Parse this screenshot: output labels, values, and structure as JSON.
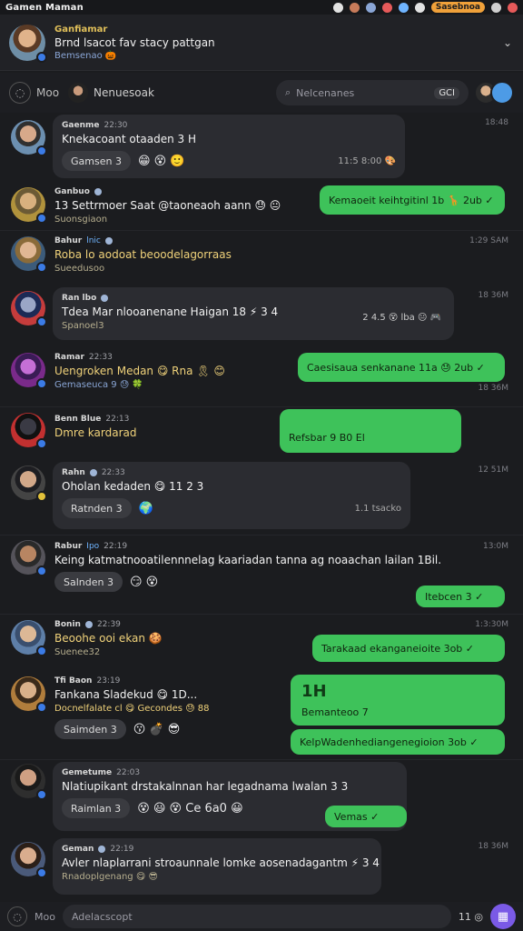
{
  "status_bar": {
    "title": "Gamen Maman",
    "pill": "Sasebnoa"
  },
  "header": {
    "name": "Ganfiamar",
    "status": "Brnd lsacot fav stacy pattgan",
    "sub": "Bemsenao 🎃"
  },
  "toolbar": {
    "left_label": "Moo",
    "pill_label": "Nenuesoak",
    "search_placeholder": "Nelcenanes",
    "search_chip": "GCI"
  },
  "messages": [
    {
      "name": "Gaenme",
      "time": "22:30",
      "text": "Knekacoant otaaden 3 H",
      "reaction_label": "Gamsen 3",
      "reactions": "😁 😵 🙂",
      "meta_right": "11:5 8:00 🎨",
      "stamp": "18:48",
      "green": ""
    },
    {
      "name": "Ganbuo",
      "tag": "",
      "text": "13 Settrmoer Saat @taoneaoh aann 😓 😐",
      "sub": "Suonsgiaon",
      "stamp": "",
      "green": "Kemaoeit keihtgitinl 1b 🦒 2ub ✓"
    },
    {
      "name": "Bahur",
      "tag": "lnic",
      "text": "Roba lo aodoat beoodelagorraas",
      "sub": "Sueedusoo",
      "stamp": "1:29 SAM",
      "green": ""
    },
    {
      "name": "Ran lbo",
      "text": "Tdea Mar nlooanenane Haigan 18 ⚡ 3 4",
      "meta_right": "2 4.5 😵 lba 😐 🎮",
      "sub": "Spanoel3",
      "stamp": "18 36M",
      "green": ""
    },
    {
      "name": "Ramar",
      "time": "22:33",
      "text": "Uengroken Medan 😋 Rna 🎗 😊",
      "sub": "Gemaseuca 9 😓 🍀",
      "stamp": "18 36M",
      "green": "Caesisaua senkanane 11a 😓 2ub ✓"
    },
    {
      "name": "Benn Blue",
      "time": "22:13",
      "text": "Dmre kardarad",
      "stamp": "",
      "green": "Refsbar 9 B0 El"
    },
    {
      "name": "Rahn",
      "tag": "",
      "time": "22:33",
      "text": "Oholan kedaden 😋 11 2 3",
      "reaction_label": "Ratnden 3",
      "reactions": "🌍",
      "meta_right": "1.1 tsacko",
      "stamp": "12 51M",
      "green": ""
    },
    {
      "name": "Rabur",
      "tag": "Ipo",
      "time": "22:19",
      "text": "Keing katmatnooatilennnelag kaariadan tanna ag noaachan lailan 1Bil.",
      "reaction_label": "Salnden 3",
      "reactions": "😏 😵",
      "stamp": "13:0M",
      "green": "Itebcen 3 ✓"
    },
    {
      "name": "Bonin",
      "time": "22:39",
      "text": "Beoohe ooi ekan 🍪",
      "sub": "Suenee32",
      "stamp": "1:3:30M",
      "green": "Tarakaad ekanganeioite 3ob ✓"
    },
    {
      "name": "Tfi Baon",
      "time": "23:19",
      "text": "Fankana Sladekud 😋 1D...",
      "sub": "Docnelfalate cl 😋 Gecondes 😓 88",
      "reaction_label": "Saimden 3",
      "reactions": "😗 💣 😎",
      "stamp": "",
      "green_big": "1H",
      "green_small": "Bemanteoo 7",
      "green2": "KelpWadenhediangenegioion 3ob ✓"
    },
    {
      "name": "Gemetume",
      "time": "22:03",
      "text": "Nlatiupikant drstakalnnan har legadnama lwalan 3 3",
      "reaction_label": "Raimlan 3",
      "reactions": "😵 😃 😵 Ce 6a0 😀",
      "stamp": "",
      "green": "Vemas ✓"
    },
    {
      "name": "Geman",
      "time": "22:19",
      "text": "Avler nlaplarrani stroaunnale lomke aosenadagantm ⚡ 3 4",
      "sub": "Rnadoplgenang 😋 😎",
      "stamp": "18 36M",
      "green": ""
    }
  ],
  "composer": {
    "label": "Moo",
    "placeholder": "Adelacscopt",
    "tools": "11 ◎"
  },
  "colors": {
    "background": "#1b1c1f",
    "bubble": "#2b2c31",
    "accent_green": "#3ec25a",
    "accent_purple": "#7a5ae6"
  }
}
